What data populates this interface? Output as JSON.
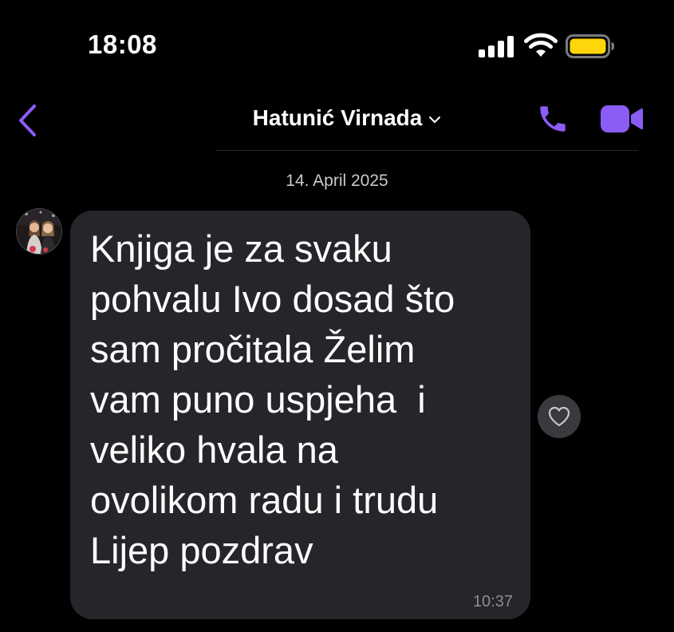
{
  "status_bar": {
    "time": "18:08",
    "signal_icon": "cellular-signal-icon",
    "wifi_icon": "wifi-icon",
    "battery_icon": "battery-icon",
    "battery_color": "#ffd60a"
  },
  "header": {
    "back_icon": "chevron-left-icon",
    "contact_name": "Hatunić Virnada",
    "dropdown_icon": "chevron-down-icon",
    "call_icon": "phone-icon",
    "video_icon": "video-camera-icon",
    "accent_color": "#8b5cf6"
  },
  "conversation": {
    "date": "14. April 2025",
    "messages": [
      {
        "text": "Knjiga je za svaku\npohvalu Ivo dosad što\nsam pročitala Želim\nvam puno uspjeha  i\nveliko hvala na\novolikom radu i trudu\nLijep pozdrav",
        "time": "10:37",
        "reaction_icon": "heart-outline-icon"
      }
    ]
  }
}
